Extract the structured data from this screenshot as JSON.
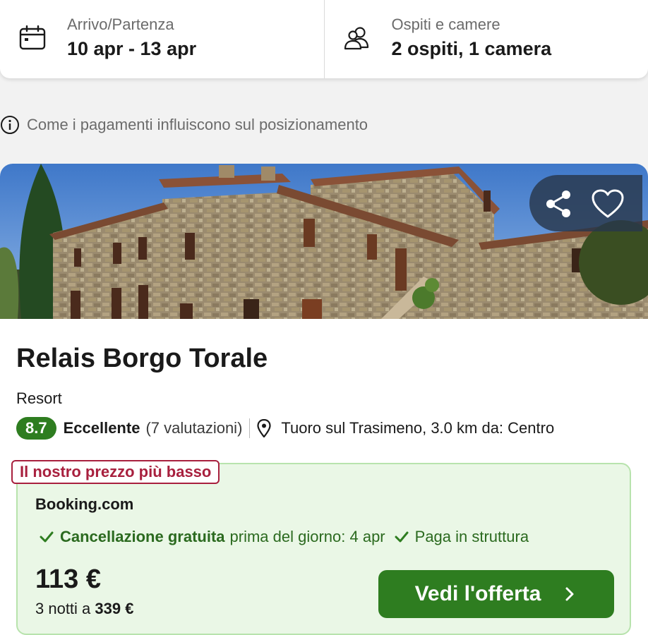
{
  "search": {
    "dates_label": "Arrivo/Partenza",
    "dates_value": "10 apr - 13 apr",
    "guests_label": "Ospiti e camere",
    "guests_value": "2 ospiti, 1 camera"
  },
  "info": {
    "text": "Come i pagamenti influiscono sul posizionamento"
  },
  "hotel": {
    "name": "Relais Borgo Torale",
    "type": "Resort",
    "rating": "8.7",
    "rating_word": "Eccellente",
    "rating_count": "(7 valutazioni)",
    "location": "Tuoro sul Trasimeno, 3.0 km da: Centro"
  },
  "offer": {
    "tag": "Il nostro prezzo più basso",
    "provider": "Booking.com",
    "perk1_strong": "Cancellazione gratuita",
    "perk1_rest": "prima del giorno: 4 apr",
    "perk2": "Paga in struttura",
    "price": "113 €",
    "total_prefix": "3 notti a",
    "total_amount": "339 €",
    "cta_label": "Vedi l'offerta"
  },
  "icons": {
    "calendar": "calendar-icon",
    "guests": "users-icon",
    "info": "info-icon",
    "share": "share-icon",
    "favorite": "heart-icon",
    "location": "map-pin-icon",
    "check": "check-icon",
    "chevron": "chevron-right-icon"
  },
  "colors": {
    "accent_green": "#2e7d20",
    "offer_bg": "#eaf7e6",
    "tag_red": "#a8203e"
  }
}
